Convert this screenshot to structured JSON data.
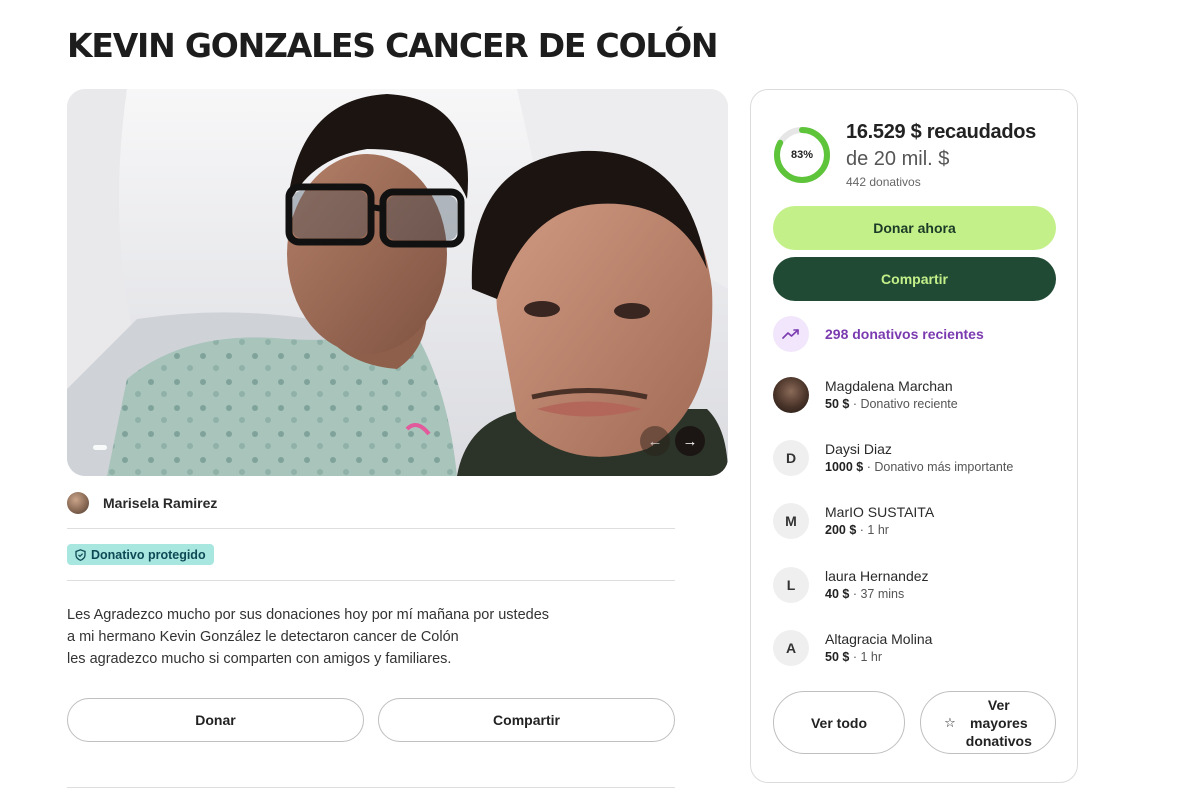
{
  "campaign": {
    "title": "KEVIN GONZALES CANCER DE COLÓN",
    "organizer": "Marisela Ramirez",
    "badge": "Donativo protegido",
    "description": [
      "Les Agradezco mucho por sus donaciones hoy por mí mañana por ustedes",
      "a mi hermano Kevin González le detectaron cancer de Colón",
      "les agradezco mucho si comparten con amigos y familiares."
    ],
    "donate_label": "Donar",
    "share_label": "Compartir",
    "carousel": {
      "prev_icon": "arrow-left-icon",
      "next_icon": "arrow-right-icon"
    }
  },
  "sidebar": {
    "progress_percent": 83,
    "progress_label": "83%",
    "raised": "16.529 $ recaudados",
    "goal": "de 20 mil. $",
    "donations_count": "442 donativos",
    "donate_now_label": "Donar ahora",
    "share_label": "Compartir",
    "recent_label": "298 donativos recientes",
    "donors": [
      {
        "initial": "",
        "avatar": "photo",
        "name": "Magdalena Marchan",
        "amount": "50 $",
        "detail": " · Donativo reciente"
      },
      {
        "initial": "D",
        "name": "Daysi Diaz",
        "amount": "1000 $",
        "detail": " · Donativo más importante"
      },
      {
        "initial": "M",
        "name": "MarIO SUSTAITA",
        "amount": "200 $",
        "detail": " · 1 hr"
      },
      {
        "initial": "L",
        "name": "laura Hernandez",
        "amount": "40 $",
        "detail": " · 37 mins"
      },
      {
        "initial": "A",
        "name": "Altagracia Molina",
        "amount": "50 $",
        "detail": " · 1 hr"
      }
    ],
    "see_all_label": "Ver todo",
    "top_donations_label": [
      "Ver",
      "mayores",
      "donativos"
    ]
  },
  "colors": {
    "accent_green": "#c4f08a",
    "dark_green": "#214a35",
    "purple": "#7a3bb0",
    "badge_bg": "#a8e6e0"
  }
}
